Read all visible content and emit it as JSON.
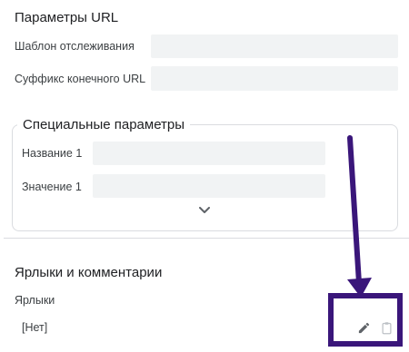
{
  "url_params": {
    "title": "Параметры URL",
    "tracking_template_label": "Шаблон отслеживания",
    "tracking_template_value": "",
    "final_url_suffix_label": "Суффикс конечного URL",
    "final_url_suffix_value": ""
  },
  "custom_params": {
    "title": "Специальные параметры",
    "name_label": "Название 1",
    "name_value": "",
    "value_label": "Значение 1",
    "value_value": "",
    "expand_icon": "chevron-down-icon"
  },
  "labels_comments": {
    "title": "Ярлыки и комментарии",
    "labels_label": "Ярлыки",
    "labels_value": "[Нет]",
    "edit_icon": "pencil-icon",
    "paste_icon": "clipboard-icon"
  },
  "annotation": {
    "color": "#3a167a"
  }
}
